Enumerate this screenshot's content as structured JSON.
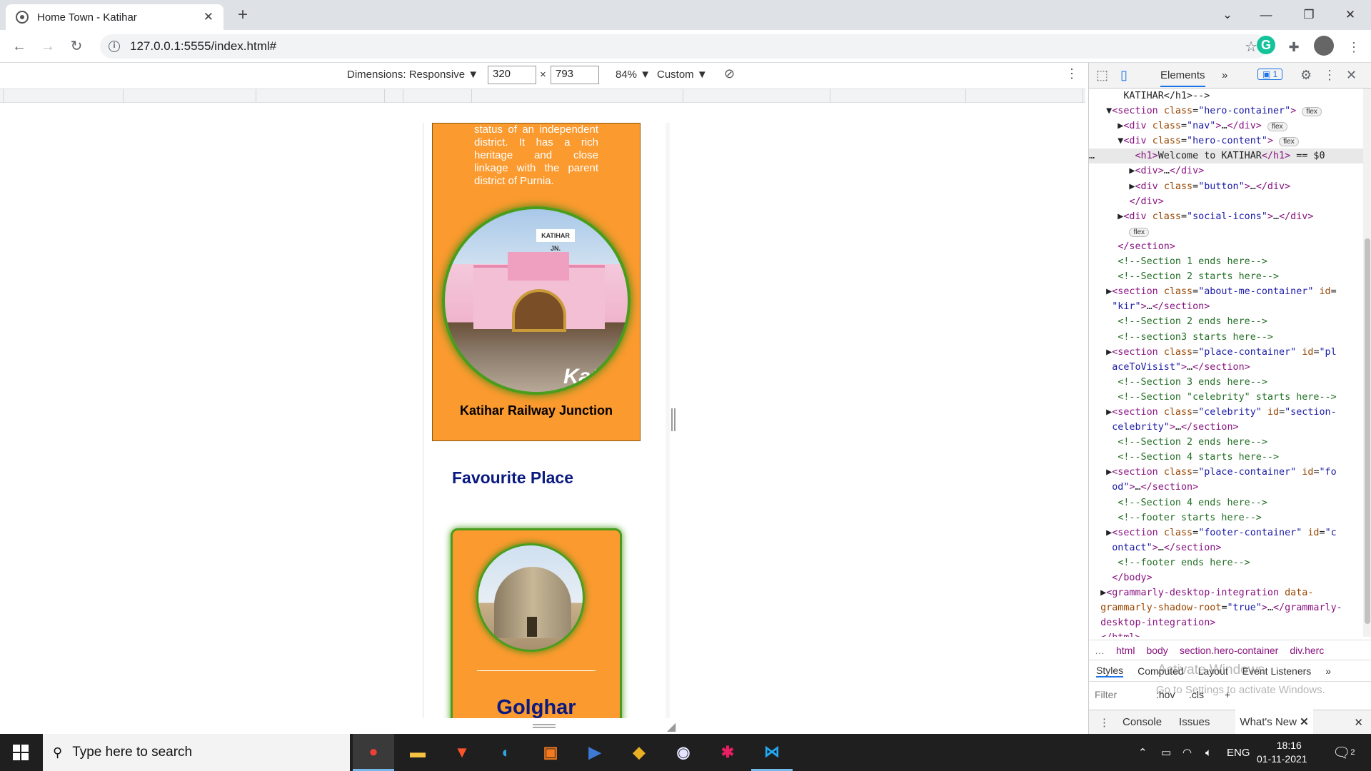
{
  "browser": {
    "tab_title": "Home Town - Katihar",
    "tab_close": "✕",
    "new_tab": "+",
    "url": "127.0.0.1:5555/index.html#",
    "window_controls": {
      "chevron": "⌄",
      "minimize": "—",
      "restore": "❐",
      "close": "✕"
    }
  },
  "device_toolbar": {
    "dimensions_label": "Dimensions: Responsive ▼",
    "width": "320",
    "times": "×",
    "height": "793",
    "zoom": "84% ▼",
    "throttle": "Custom ▼"
  },
  "page": {
    "intro_text": "status of an independent district. It has a rich heritage and close linkage with the parent district of Purnia.",
    "railway_sign": "KATIHAR JN.",
    "railway_watermark": "Kati",
    "railway_caption": "Katihar Railway Junction",
    "favourite_heading": "Favourite Place",
    "place_name": "Golghar",
    "accent_orange": "#fb9a2f",
    "accent_green": "#4a9d1c",
    "heading_blue": "#0a1a80"
  },
  "devtools": {
    "tab_elements": "Elements",
    "more_tabs": "»",
    "issues_count": "1",
    "crumbs": [
      "html",
      "body",
      "section.hero-container",
      "div.herc"
    ],
    "crumbs_more": "…",
    "subtabs": [
      "Styles",
      "Computed",
      "Layout",
      "Event Listeners"
    ],
    "subtabs_more": "»",
    "filter_placeholder": "Filter",
    "filter_hov": ":hov",
    "filter_cls": ".cls",
    "drawer_tabs": [
      "Console",
      "Issues",
      "What's New"
    ],
    "watermark_1": "Activate Windows",
    "watermark_2": "Go to Settings to activate Windows."
  },
  "taskbar": {
    "search_placeholder": "Type here to search",
    "lang": "ENG",
    "time": "18:16",
    "date": "01-11-2021",
    "notifications": "2"
  }
}
